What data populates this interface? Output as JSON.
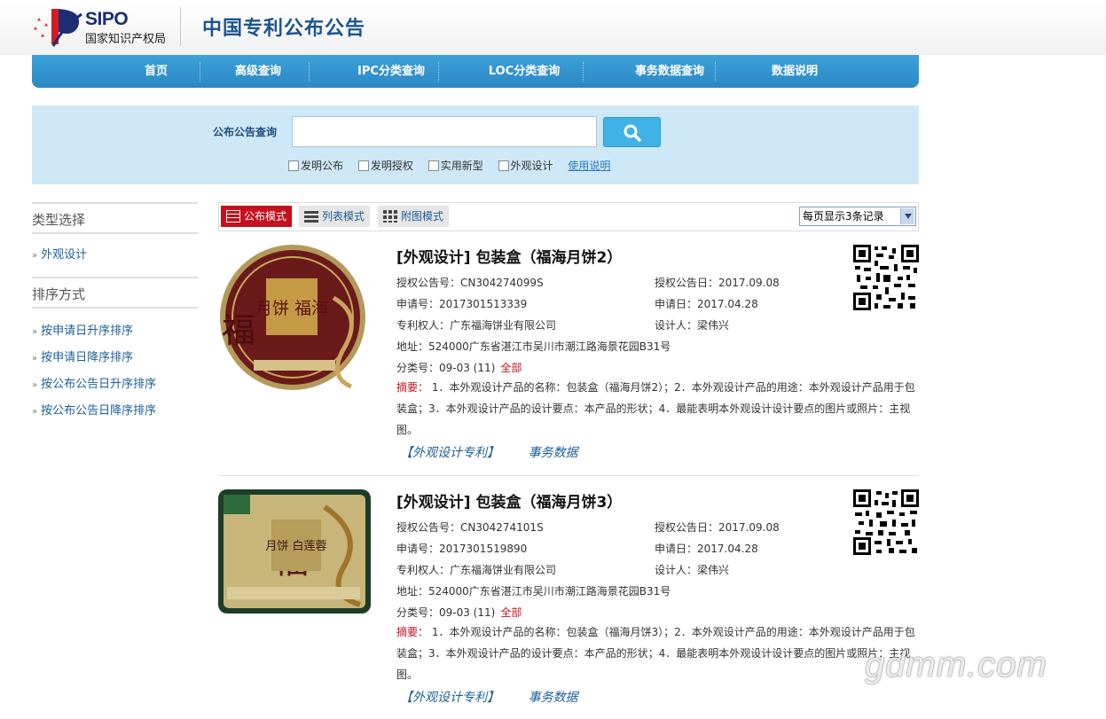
{
  "header": {
    "logo_text": "SIPO",
    "logo_cn": "国家知识产权局",
    "title": "中国专利公布公告"
  },
  "nav": [
    "首页",
    "高级查询",
    "IPC分类查询",
    "LOC分类查询",
    "事务数据查询",
    "数据说明"
  ],
  "search": {
    "label": "公布公告查询",
    "value": "",
    "filters": [
      "发明公布",
      "发明授权",
      "实用新型",
      "外观设计"
    ],
    "usage_link": "使用说明"
  },
  "sidebar": {
    "type_heading": "类型选择",
    "type_items": [
      "外观设计"
    ],
    "sort_heading": "排序方式",
    "sort_items": [
      "按申请日升序排序",
      "按申请日降序排序",
      "按公布公告日升序排序",
      "按公布公告日降序排序"
    ]
  },
  "toolbar": {
    "modes": [
      "公布模式",
      "列表模式",
      "附图模式"
    ],
    "per_page": "每页显示3条记录"
  },
  "records": [
    {
      "title": "[外观设计] 包装盒（福海月饼2）",
      "grant_no": "授权公告号：CN304274099S",
      "grant_date": "授权公告日：2017.09.08",
      "app_no": "申请号：2017301513339",
      "app_date": "申请日：2017.04.28",
      "owner": "专利权人：广东福海饼业有限公司",
      "designer": "设计人：梁伟兴",
      "address": "地址：524000广东省湛江市吴川市潮江路海景花园B31号",
      "class": "分类号：09-03 (11)",
      "all_label": "全部",
      "abstract_label": "摘要：",
      "abstract": "1．本外观设计产品的名称：包装盒（福海月饼2）；2．本外观设计产品的用途：本外观设计产品用于包装盒；3．本外观设计产品的设计要点：本产品的形状；4．最能表明本外观设计设计要点的图片或照片：主视图。",
      "link1": "【外观设计专利】",
      "link2": "事务数据",
      "image_text": "月饼 福海"
    },
    {
      "title": "[外观设计] 包装盒（福海月饼3）",
      "grant_no": "授权公告号：CN304274101S",
      "grant_date": "授权公告日：2017.09.08",
      "app_no": "申请号：2017301519890",
      "app_date": "申请日：2017.04.28",
      "owner": "专利权人：广东福海饼业有限公司",
      "designer": "设计人：梁伟兴",
      "address": "地址：524000广东省湛江市吴川市潮江路海景花园B31号",
      "class": "分类号：09-03 (11)",
      "all_label": "全部",
      "abstract_label": "摘要：",
      "abstract": "1．本外观设计产品的名称：包装盒（福海月饼3）；2．本外观设计产品的用途：本外观设计产品用于包装盒；3．本外观设计产品的设计要点：本产品的形状；4．最能表明本外观设计设计要点的图片或照片：主视图。",
      "link1": "【外观设计专利】",
      "link2": "事务数据",
      "image_text": "月饼 白莲蓉"
    }
  ],
  "watermark": "gdmm.com",
  "colors": {
    "nav": "#2c88c5",
    "search_bg": "#cfe8f7",
    "accent_red": "#c4111d",
    "link": "#1c5f99"
  }
}
